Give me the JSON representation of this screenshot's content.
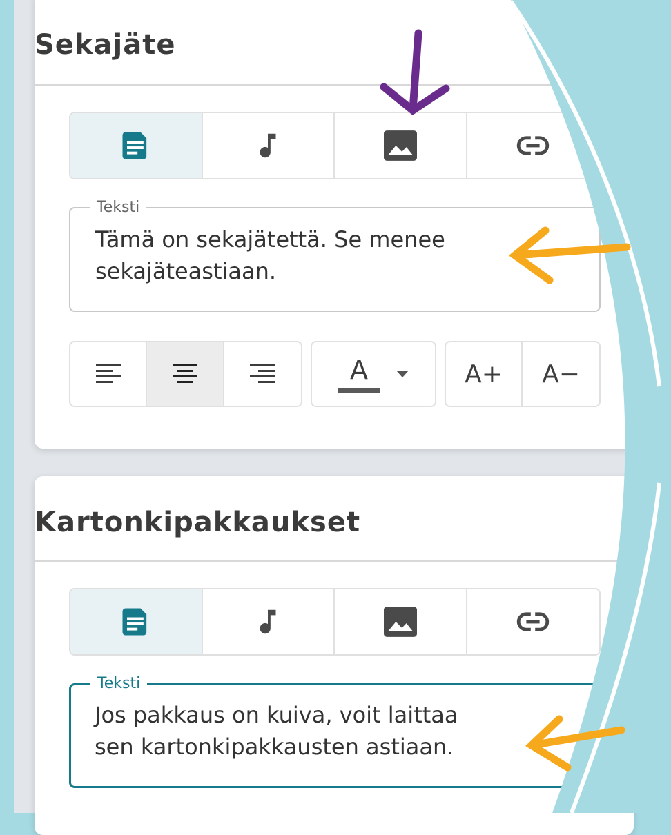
{
  "cards": [
    {
      "title": "Sekajäte",
      "tabs": [
        {
          "icon": "document-icon",
          "active": true
        },
        {
          "icon": "music-note-icon",
          "active": false
        },
        {
          "icon": "image-icon",
          "active": false
        },
        {
          "icon": "link-icon",
          "active": false
        }
      ],
      "text_field": {
        "label": "Teksti",
        "lines": [
          "Tämä on sekajätettä. Se menee",
          "sekajäteastiaan."
        ]
      },
      "format_toolbar": {
        "align": [
          {
            "icon": "align-left-icon",
            "active": false
          },
          {
            "icon": "align-center-icon",
            "active": true
          },
          {
            "icon": "align-right-icon",
            "active": false
          }
        ],
        "text_color": {
          "letter": "A",
          "icon": "caret-down-icon"
        },
        "size_increase_label": "A+",
        "size_decrease_label": "A−"
      }
    },
    {
      "title": "Kartonkipakkaukset",
      "tabs": [
        {
          "icon": "document-icon",
          "active": true
        },
        {
          "icon": "music-note-icon",
          "active": false
        },
        {
          "icon": "image-icon",
          "active": false
        },
        {
          "icon": "link-icon",
          "active": false
        }
      ],
      "text_field": {
        "label": "Teksti",
        "lines": [
          "Jos pakkaus on kuiva, voit laittaa",
          "sen kartonkipakkausten astiaan."
        ],
        "focused": true
      }
    }
  ],
  "colors": {
    "accent": "#177a8a",
    "background": "#a6dae3",
    "annotation_purple": "#6a2c8c",
    "annotation_orange": "#f6a91c"
  },
  "annotations": [
    {
      "type": "arrow",
      "color": "purple",
      "direction": "down",
      "points_to": "image-icon"
    },
    {
      "type": "arrow",
      "color": "orange",
      "direction": "left",
      "points_to": "card-1-text"
    },
    {
      "type": "arrow",
      "color": "orange",
      "direction": "left",
      "points_to": "card-2-text"
    }
  ]
}
